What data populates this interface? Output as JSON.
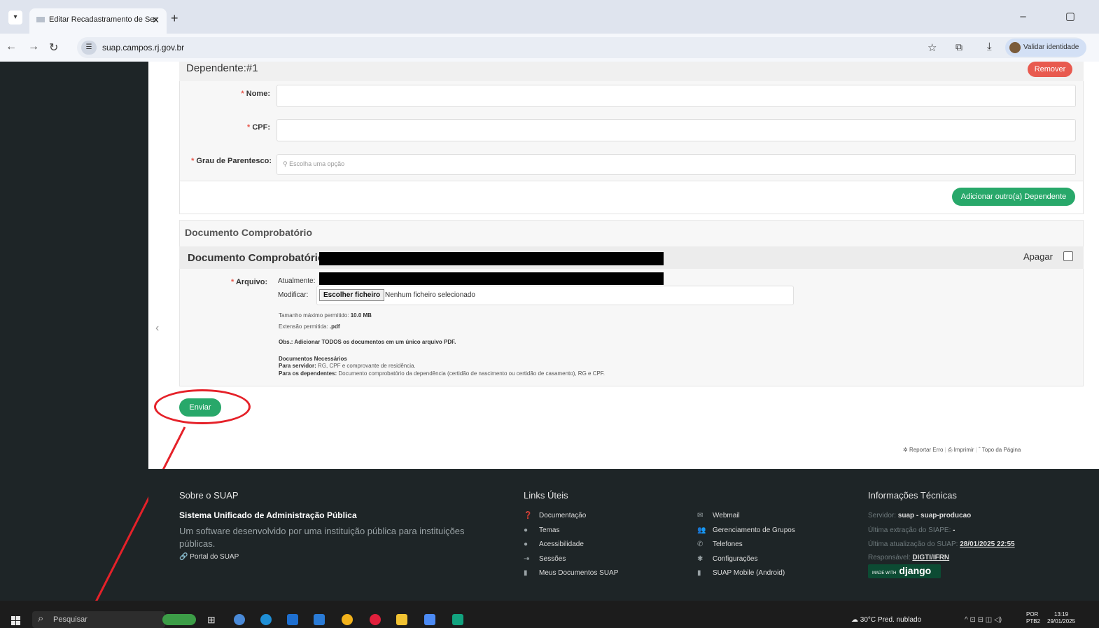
{
  "browser": {
    "tab_title": "Editar Recadastramento de Ser",
    "tab_close": "✕",
    "new_tab": "+",
    "window_buttons": "–  ▢",
    "url": "suap.campos.rj.gov.br",
    "validar": "Validar identidade",
    "back_icon": "back-arrow-icon",
    "forward_icon": "forward-arrow-icon",
    "reload_icon": "reload-icon"
  },
  "dependente": {
    "title": "Dependente:",
    "number": "#1",
    "remover": "Remover",
    "nome_label": "Nome:",
    "cpf_label": "CPF:",
    "grau_label": "Grau de Parentesco:",
    "grau_placeholder": "Escolha uma opção",
    "add_button": "Adicionar outro(a) Dependente"
  },
  "documento": {
    "section_title": "Documento Comprobatório",
    "header": "Documento Comprobatório:",
    "apagar": "Apagar",
    "arquivo_label": "Arquivo:",
    "atualmente": "Atualmente:",
    "modificar": "Modificar:",
    "file_button": "Escolher ficheiro",
    "file_none": "Nenhum ficheiro selecionado",
    "max_size_label": "Tamanho máximo permitido:",
    "max_size": "10.0 MB",
    "ext_label": "Extensão permitida:",
    "ext": ".pdf",
    "obs": "Obs.: Adicionar TODOS os documentos em um único arquivo PDF.",
    "docs_title": "Documentos Necessários",
    "para_servidor_label": "Para servidor:",
    "para_servidor": "RG, CPF e comprovante de residência.",
    "para_dep_label": "Para os dependentes:",
    "para_dep": "Documento comprobatório da dependência (certidão de nascimento ou certidão de casamento), RG e CPF."
  },
  "enviar": "Enviar",
  "page_links": {
    "reportar": "Reportar Erro",
    "imprimir": "Imprimir",
    "topo": "Topo da Página"
  },
  "footer": {
    "sobre_title": "Sobre o SUAP",
    "sobre_strong": "Sistema Unificado de Administração Pública",
    "sobre_desc": "Um software desenvolvido por uma instituição pública para instituições públicas.",
    "portal": "Portal do SUAP",
    "links_title": "Links Úteis",
    "links_col1": [
      "Documentação",
      "Temas",
      "Acessibilidade",
      "Sessões",
      "Meus Documentos SUAP"
    ],
    "links_col2": [
      "Webmail",
      "Gerenciamento de Grupos",
      "Telefones",
      "Configurações",
      "SUAP Mobile (Android)"
    ],
    "tech_title": "Informações Técnicas",
    "servidor_label": "Servidor:",
    "servidor": "suap - suap-producao",
    "siape_label": "Última extração do SIAPE:",
    "siape": "-",
    "atualizacao_label": "Última atualização do SUAP:",
    "atualizacao": "28/01/2025 22:55",
    "responsavel_label": "Responsável:",
    "responsavel": "DIGTI/IFRN",
    "django_small": "MADE WITH",
    "django": "django"
  },
  "taskbar": {
    "search": "Pesquisar",
    "weather": "30°C  Pred. nublado",
    "lang1": "POR",
    "lang2": "PTB2",
    "time": "13:19",
    "date": "29/01/2025"
  },
  "colors": {
    "accent_green": "#28a86a",
    "remove_red": "#e85a4f",
    "annotation_red": "#e52129",
    "sidebar_dark": "#1e2527"
  }
}
